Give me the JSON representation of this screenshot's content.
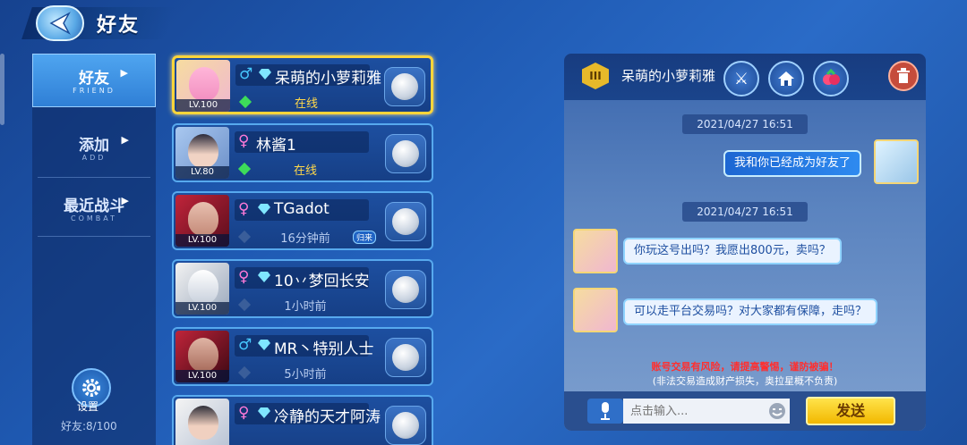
{
  "header": {
    "title": "好友"
  },
  "nav": {
    "items": [
      {
        "label": "好友",
        "sub": "FRIEND",
        "active": true
      },
      {
        "label": "添加",
        "sub": "ADD",
        "active": false
      },
      {
        "label": "最近战斗",
        "sub": "COMBAT",
        "active": false
      }
    ],
    "settings_label": "设置",
    "friend_count": "好友:8/100"
  },
  "friends": [
    {
      "name": "呆萌的小萝莉雅",
      "gender": "♂",
      "level": "LV.100",
      "status": "在线",
      "online": true,
      "vip": true,
      "selected": true
    },
    {
      "name": "林酱1",
      "gender": "♀",
      "level": "LV.80",
      "status": "在线",
      "online": true,
      "vip": false,
      "selected": false
    },
    {
      "name": "TGadot",
      "gender": "♀",
      "level": "LV.100",
      "status": "16分钟前",
      "online": false,
      "vip": true,
      "selected": false,
      "badge": "归来"
    },
    {
      "name": "10丷梦回长安",
      "gender": "♀",
      "level": "LV.100",
      "status": "1小时前",
      "online": false,
      "vip": true,
      "selected": false
    },
    {
      "name": "MR丶特别人士",
      "gender": "♂",
      "level": "LV.100",
      "status": "5小时前",
      "online": false,
      "vip": true,
      "selected": false
    },
    {
      "name": "冷静的天才阿涛",
      "gender": "♀",
      "level": "",
      "status": "",
      "online": false,
      "vip": true,
      "selected": false
    }
  ],
  "chat": {
    "partner_name": "呆萌的小萝莉雅",
    "rank_icon": "III",
    "messages": [
      {
        "timestamp": "2021/04/27 16:51"
      },
      {
        "from": "me",
        "text": "我和你已经成为好友了"
      },
      {
        "timestamp": "2021/04/27 16:51"
      },
      {
        "from": "partner",
        "text": "你玩这号出吗？我愿出800元，卖吗？"
      },
      {
        "from": "partner",
        "text": "可以走平台交易吗？对大家都有保障，走吗？"
      }
    ],
    "warning": "账号交易有风险，请提高警惕，谨防被骗！",
    "disclaimer": "(非法交易造成财产损失，奥拉星概不负责)",
    "input_placeholder": "点击输入...",
    "send_label": "发送"
  },
  "colors": {
    "male": "#46c8ff",
    "female": "#ff7ad9",
    "online": "#ffd84a",
    "offline": "#b9cdf0",
    "warning": "#ff2f2f",
    "send": "#f2b800"
  }
}
